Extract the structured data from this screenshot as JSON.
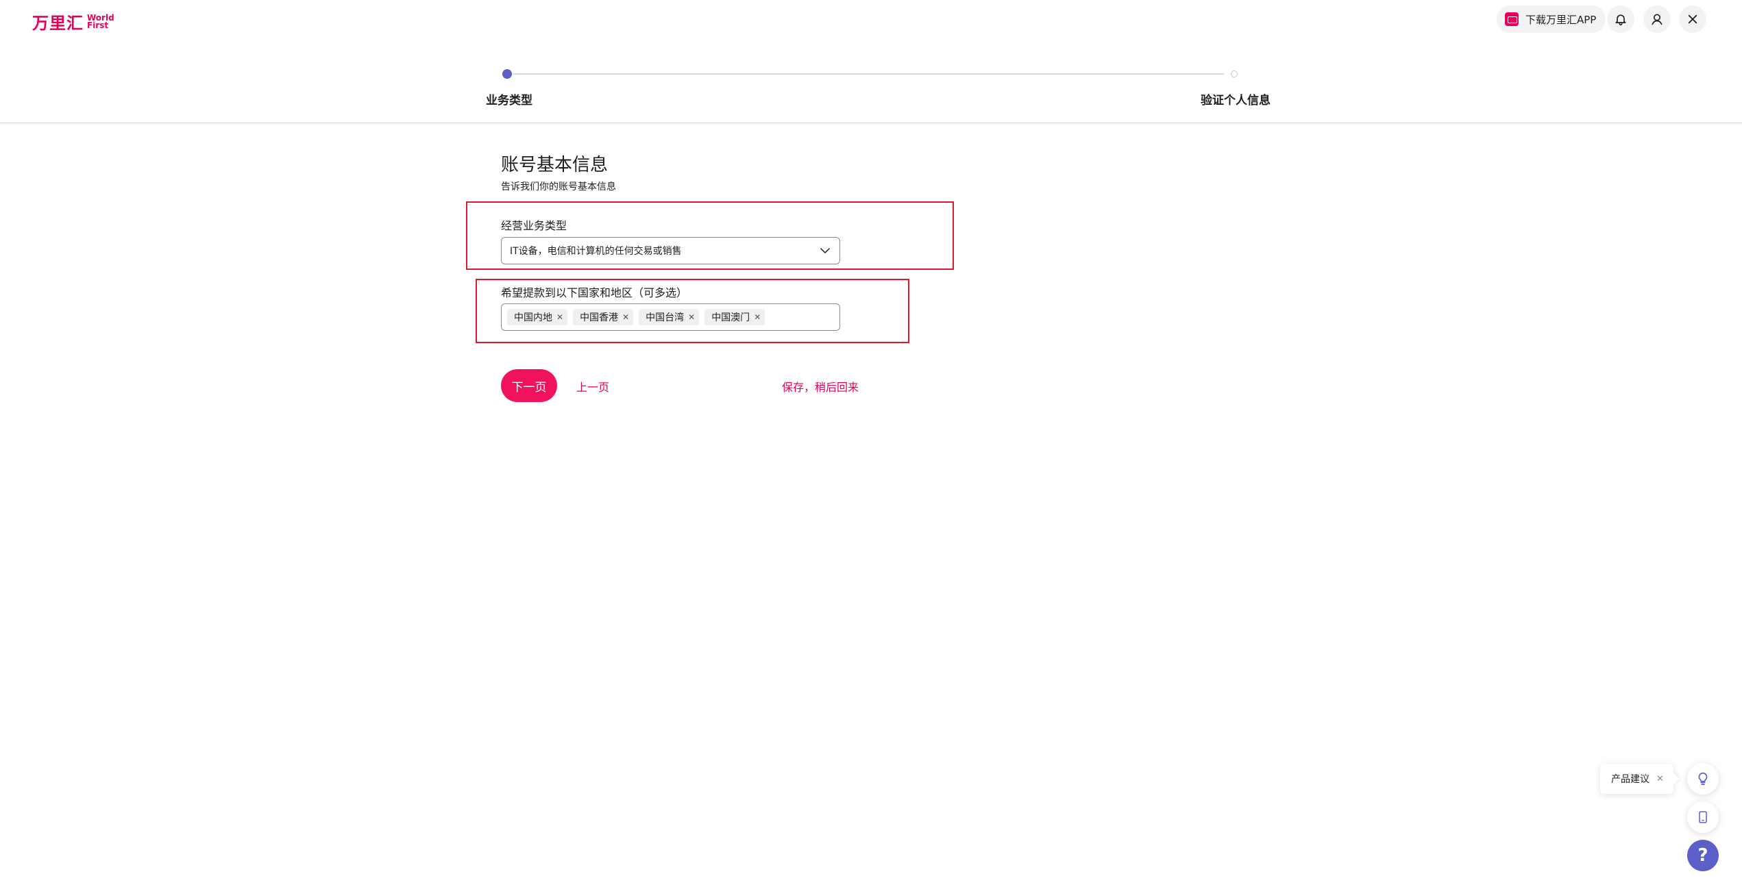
{
  "header": {
    "logo_cn": "万里汇",
    "logo_en_line1": "World",
    "logo_en_line2": "First",
    "download_label": "下载万里汇APP"
  },
  "stepper": {
    "steps": [
      {
        "label": "业务类型",
        "active": true
      },
      {
        "label": "验证个人信息",
        "active": false
      }
    ]
  },
  "form": {
    "title": "账号基本信息",
    "subtitle": "告诉我们你的账号基本信息",
    "business_type": {
      "label": "经营业务类型",
      "value": "IT设备，电信和计算机的任何交易或销售"
    },
    "withdraw_regions": {
      "label": "希望提款到以下国家和地区（可多选）",
      "tags": [
        "中国内地",
        "中国香港",
        "中国台湾",
        "中国澳门"
      ]
    }
  },
  "actions": {
    "next_label": "下一页",
    "prev_label": "上一页",
    "save_label": "保存，稍后回来"
  },
  "widgets": {
    "suggest_label": "产品建议",
    "help_label": "?"
  },
  "colors": {
    "brand": "#e6005c",
    "accent": "#5b5fc7",
    "outline": "#e0162b"
  }
}
